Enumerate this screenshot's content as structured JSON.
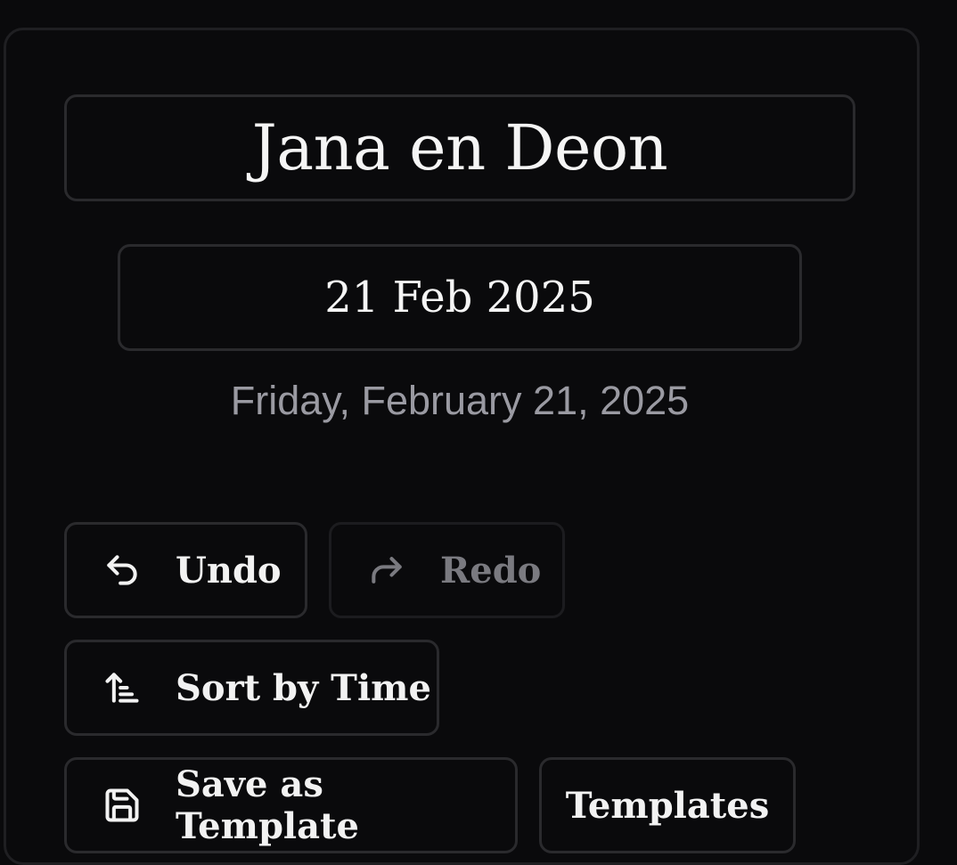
{
  "event": {
    "title": "Jana en Deon",
    "date_short": "21 Feb 2025",
    "date_long": "Friday, February 21, 2025"
  },
  "actions": {
    "undo": {
      "label": "Undo",
      "icon": "undo-icon",
      "enabled": true
    },
    "redo": {
      "label": "Redo",
      "icon": "redo-icon",
      "enabled": false
    },
    "sort": {
      "label": "Sort by Time",
      "icon": "sort-ascending-icon"
    },
    "save_template": {
      "label": "Save as Template",
      "icon": "save-icon"
    },
    "templates": {
      "label": "Templates"
    }
  },
  "colors": {
    "background": "#0a0a0c",
    "border": "#2a2a2d",
    "text": "#f5f5f5",
    "muted_text": "#9a9aa2",
    "disabled_text": "#7a7a80"
  }
}
